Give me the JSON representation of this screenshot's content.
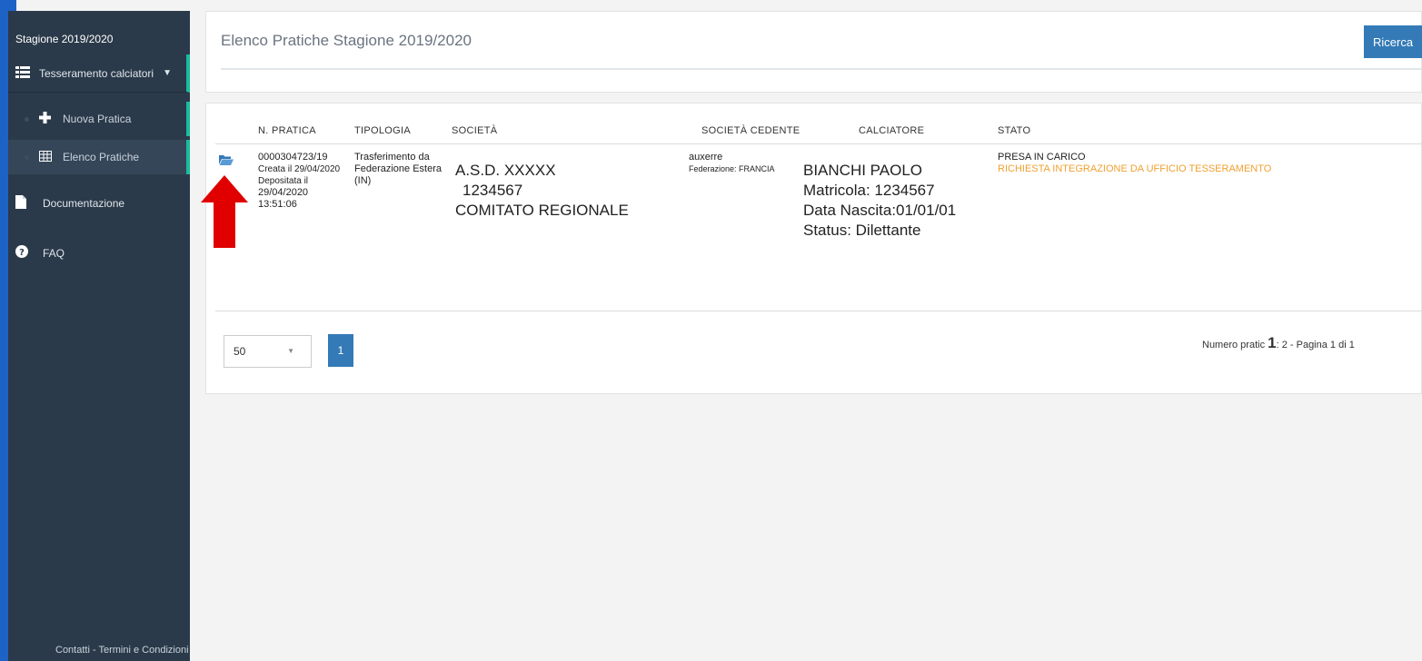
{
  "sidebar": {
    "season": "Stagione 2019/2020",
    "group_label": "Tesseramento calciatori",
    "sub_items": [
      {
        "label": "Nuova Pratica"
      },
      {
        "label": "Elenco Pratiche"
      }
    ],
    "items": [
      {
        "label": "Documentazione"
      },
      {
        "label": "FAQ"
      }
    ],
    "footer": "Contatti - Termini e Condizioni"
  },
  "header": {
    "title": "Elenco Pratiche Stagione 2019/2020",
    "search_button": "Ricerca"
  },
  "table": {
    "columns": [
      "N. PRATICA",
      "TIPOLOGIA",
      "SOCIETÀ",
      "SOCIETÀ CEDENTE",
      "CALCIATORE",
      "STATO"
    ],
    "row": {
      "numero": "0000304723/19",
      "creata": "Creata il 29/04/2020",
      "depositata_label": "Depositata il",
      "depositata_date": "29/04/2020",
      "depositata_time": "13:51:06",
      "tipologia_1": "Trasferimento da",
      "tipologia_2": "Federazione Estera",
      "tipologia_3": "(IN)",
      "societa_nome": "A.S.D. XXXXX",
      "societa_matricola": "1234567",
      "societa_comitato": "COMITATO REGIONALE",
      "cedente_nome": "auxerre",
      "cedente_federazione": "Federazione: FRANCIA",
      "calciatore_nome": "BIANCHI PAOLO",
      "calciatore_matricola": "Matricola: 1234567",
      "calciatore_nascita": "Data Nascita:01/01/01",
      "calciatore_status": "Status: Dilettante",
      "stato": "PRESA IN CARICO",
      "stato_dettaglio": "RICHIESTA INTEGRAZIONE DA UFFICIO TESSERAMENTO"
    }
  },
  "pagination": {
    "page_size": "50",
    "current_page": "1",
    "info_prefix": "Numero pratic",
    "info_bold": "1",
    "info_suffix": ": 2 - Pagina 1 di 1"
  },
  "colors": {
    "sidebar_bg": "#2b3a4a",
    "accent": "#1abc9c",
    "primary": "#337ab7",
    "status_warning": "#f0a030",
    "annotation_arrow": "#e00000"
  },
  "icons": {
    "group": "table-list-icon",
    "nuova": "plus-icon",
    "elenco": "table-icon",
    "documentazione": "document-icon",
    "faq": "question-circle-icon",
    "row_action": "folder-open-icon"
  }
}
